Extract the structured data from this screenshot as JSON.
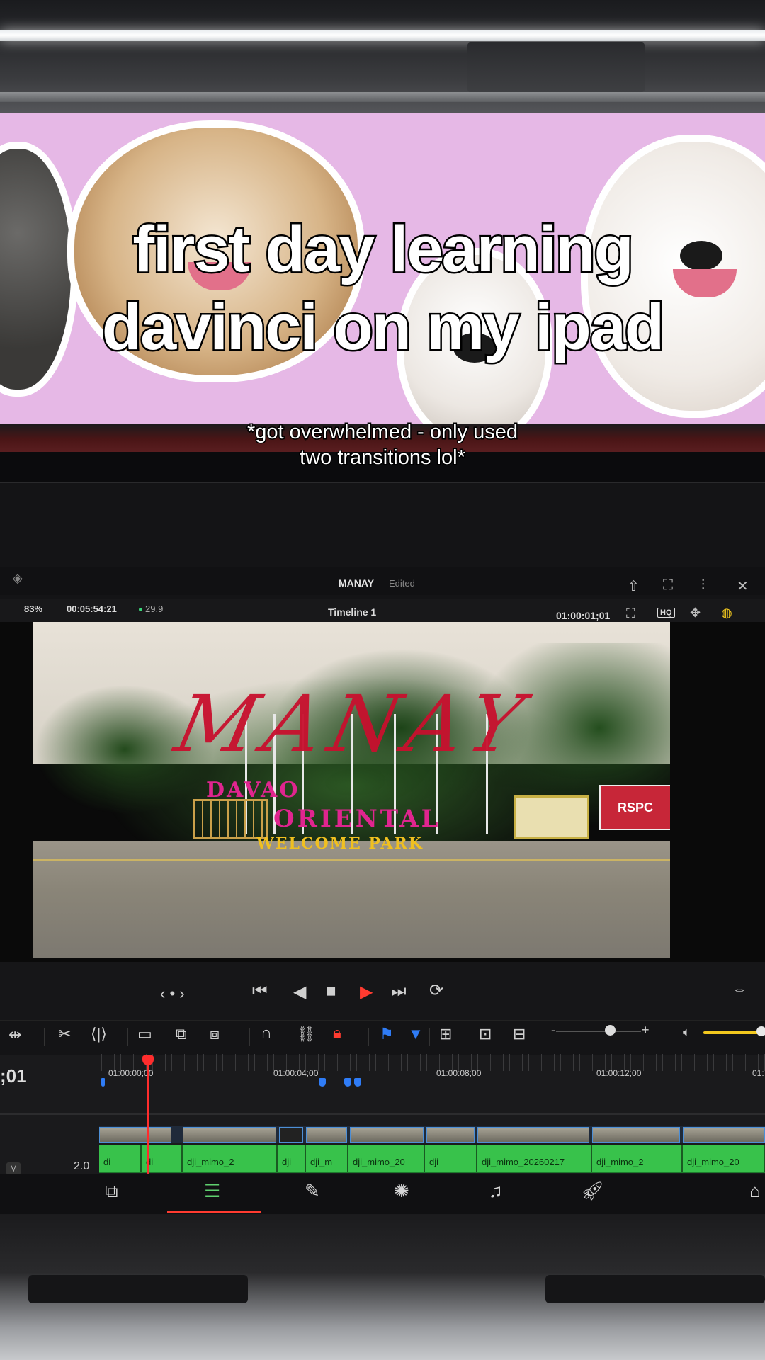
{
  "overlay": {
    "headline_line1": "first day learning",
    "headline_line2": "davinci on my ipad",
    "subtitle_line1": "*got overwhelmed - only used",
    "subtitle_line2": "two transitions lol*"
  },
  "app": {
    "project_name": "MANAY",
    "project_status": "Edited",
    "zoom_level": "83%",
    "duration": "00:05:54:21",
    "fps": "29.9",
    "timeline_name": "Timeline 1",
    "timecode": "01:00:01;01",
    "playhead_timecode": ";01",
    "hq_badge": "HQ"
  },
  "video_frame": {
    "script_title": "MANAY",
    "line1": "DAVAO",
    "line2": "ORIENTAL",
    "line3": "WELCOME PARK",
    "banner": "RSPC"
  },
  "transport": {
    "prev_next": "‹ • ›"
  },
  "ruler": {
    "labels": [
      "01:00:00;00",
      "01:00:04;00",
      "01:00:08;00",
      "01:00:12;00",
      "01:"
    ]
  },
  "audio_clips": [
    "di",
    "di",
    "dji_mimo_2",
    "dji",
    "dji_m",
    "dji_mimo_20",
    "dji",
    "dji_mimo_20260217",
    "dji_mimo_2",
    "dji_mimo_20"
  ],
  "track": {
    "label": "M",
    "volume": "2.0"
  },
  "icons": {
    "share": "share-icon",
    "fullscreen": "fullscreen-icon",
    "mixer": "mixer-icon",
    "tools": "tools-icon"
  },
  "colors": {
    "accent_red": "#ff3b30",
    "accent_blue": "#2f7cf6",
    "audio_green": "#38c24b",
    "volume_yellow": "#f2c81e"
  }
}
